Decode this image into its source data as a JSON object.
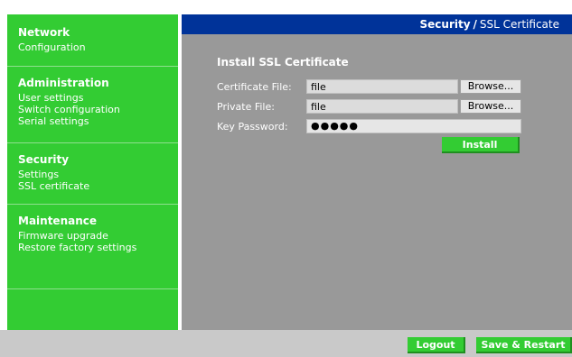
{
  "sidebar": {
    "sections": [
      {
        "title": "Network",
        "links": [
          "Configuration"
        ]
      },
      {
        "title": "Administration",
        "links": [
          "User settings",
          "Switch configuration",
          "Serial settings"
        ]
      },
      {
        "title": "Security",
        "links": [
          "Settings",
          "SSL certificate"
        ]
      },
      {
        "title": "Maintenance",
        "links": [
          "Firmware upgrade",
          "Restore factory settings"
        ]
      }
    ]
  },
  "header": {
    "section": "Security",
    "separator": "/",
    "page": "SSL Certificate"
  },
  "form": {
    "title": "Install SSL Certificate",
    "certificate_label": "Certificate File:",
    "certificate_value": "file",
    "private_label": "Private File:",
    "private_value": "file",
    "browse_label": "Browse...",
    "password_label": "Key Password:",
    "password_mask": "●●●●●",
    "install_label": "Install"
  },
  "footer": {
    "logout_label": "Logout",
    "save_restart_label": "Save & Restart"
  },
  "colors": {
    "sidebar": "#33cc33",
    "header": "#003399",
    "content": "#999999",
    "footer": "#c9c9c9"
  }
}
